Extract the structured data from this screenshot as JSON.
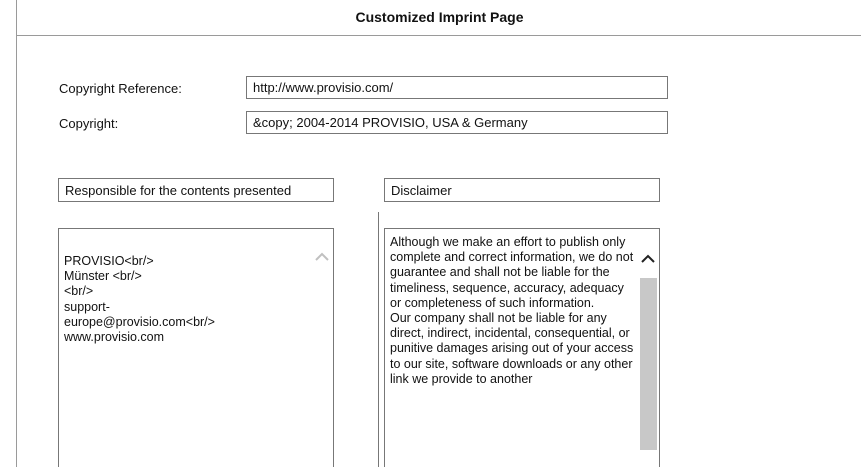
{
  "page": {
    "title": "Customized Imprint Page"
  },
  "copyright_reference": {
    "label": "Copyright Reference:",
    "value": "http://www.provisio.com/"
  },
  "copyright": {
    "label": "Copyright:",
    "value": "&copy; 2004-2014 PROVISIO, USA & Germany"
  },
  "responsible": {
    "heading": "Responsible for the contents presented",
    "content": "PROVISIO<br/>\nMünster <br/>\n<br/>\nsupport-\neurope@provisio.com<br/>\nwww.provisio.com"
  },
  "disclaimer": {
    "heading": "Disclaimer",
    "content": "Although we make an effort to publish only complete and correct information, we do not guarantee and shall not be liable for the timeliness, sequence, accuracy, adequacy or completeness of such information.\nOur company shall not be liable for any direct, indirect, incidental, consequential, or punitive damages arising out of your access to our site, software downloads or any other link we provide to another"
  },
  "icons": {
    "scroll_up": "chevron-up-icon"
  },
  "colors": {
    "border": "#777777",
    "scroll_thumb": "#c8c8c8",
    "scroll_arrow_inactive": "#c0c0c0",
    "scroll_arrow_active": "#222222"
  }
}
